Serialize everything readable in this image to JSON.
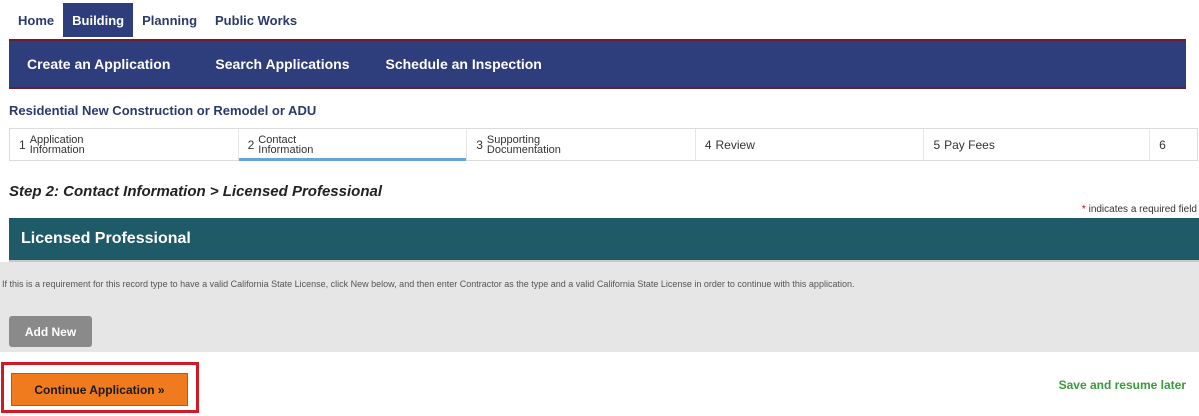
{
  "top_tabs": [
    "Home",
    "Building",
    "Planning",
    "Public Works"
  ],
  "nav": [
    "Create an Application",
    "Search Applications",
    "Schedule an Inspection"
  ],
  "record_type": "Residential New Construction or Remodel or ADU",
  "steps": [
    {
      "num": "1",
      "line1": "Application",
      "line2": "Information"
    },
    {
      "num": "2",
      "line1": "Contact",
      "line2": "Information"
    },
    {
      "num": "3",
      "line1": "Supporting",
      "line2": "Documentation"
    },
    {
      "num": "4",
      "label": "Review"
    },
    {
      "num": "5",
      "label": "Pay Fees"
    },
    {
      "num": "6"
    }
  ],
  "step_title": "Step 2: Contact Information > Licensed Professional",
  "required_note": {
    "star": "*",
    "text": " indicates a required field"
  },
  "section": {
    "title": "Licensed Professional",
    "instructions": "If this is a requirement for this record type to have a valid California State License, click New below, and then enter Contractor as the type and a valid California State License in order to continue with this application.",
    "add_new_label": "Add New"
  },
  "actions": {
    "continue_label": "Continue Application »",
    "save_later_label": "Save and resume later"
  },
  "colors": {
    "nav_blue": "#2e3e7c",
    "section_teal": "#1e5a67",
    "continue_orange": "#f07a1e",
    "highlight_red": "#d21a27",
    "save_green": "#3a9a3a",
    "active_step_underline": "#65a6d9"
  }
}
